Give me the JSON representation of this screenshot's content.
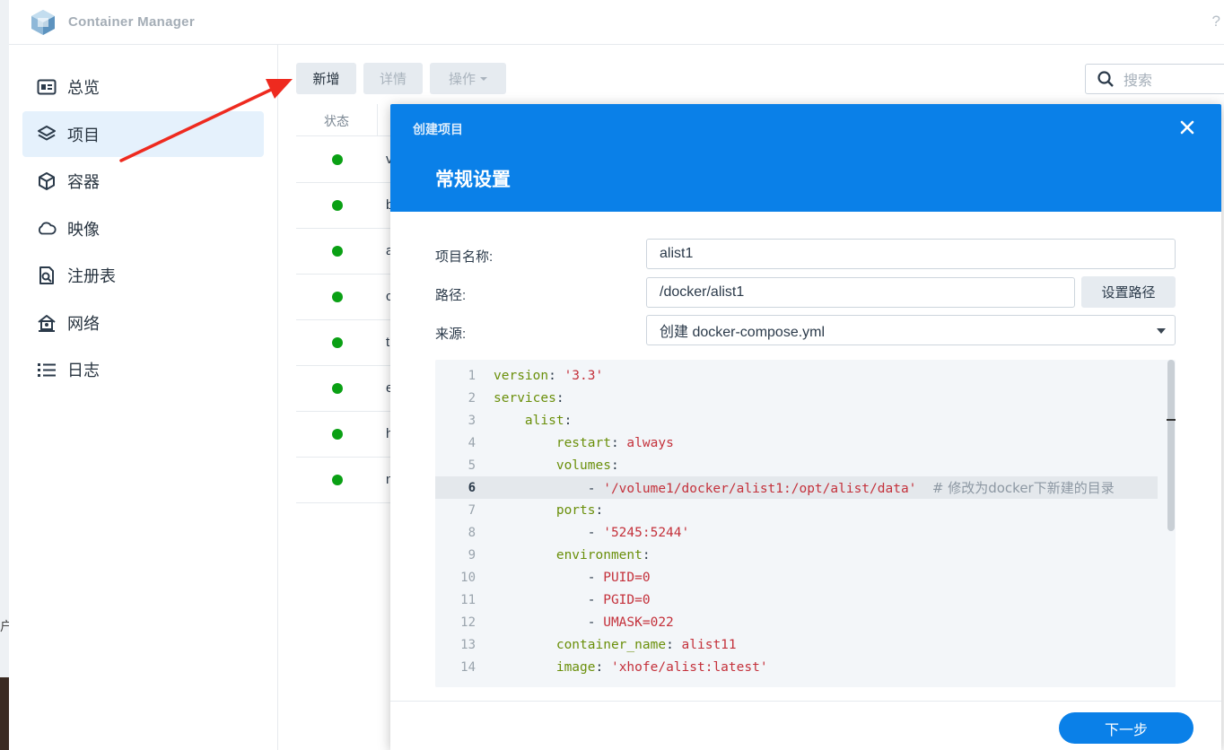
{
  "window": {
    "title": "Container Manager",
    "help_glyph": "?"
  },
  "desktop": {
    "edge_glyph": "户"
  },
  "sidebar": {
    "items": [
      {
        "label": "总览",
        "icon": "overview-card-icon"
      },
      {
        "label": "项目",
        "icon": "layers-icon",
        "active": true
      },
      {
        "label": "容器",
        "icon": "box-icon"
      },
      {
        "label": "映像",
        "icon": "cloud-icon"
      },
      {
        "label": "注册表",
        "icon": "registry-search-icon"
      },
      {
        "label": "网络",
        "icon": "network-home-icon"
      },
      {
        "label": "日志",
        "icon": "list-icon"
      }
    ]
  },
  "toolbar": {
    "new_label": "新增",
    "detail_label": "详情",
    "ops_label": "操作",
    "search_placeholder": "搜索"
  },
  "project_list": {
    "header_status": "状态",
    "rows": [
      {
        "name_fragment": "v",
        "status": "running"
      },
      {
        "name_fragment": "b",
        "status": "running"
      },
      {
        "name_fragment": "a",
        "status": "running"
      },
      {
        "name_fragment": "c",
        "status": "running"
      },
      {
        "name_fragment": "t",
        "status": "running"
      },
      {
        "name_fragment": "e",
        "status": "running"
      },
      {
        "name_fragment": "h",
        "status": "running"
      },
      {
        "name_fragment": "n",
        "status": "running"
      }
    ]
  },
  "dialog": {
    "title": "创建项目",
    "step_title": "常规设置",
    "fields": {
      "name_label": "项目名称:",
      "name_value": "alist1",
      "path_label": "路径:",
      "path_value": "/docker/alist1",
      "set_path_button": "设置路径",
      "source_label": "来源:",
      "source_value": "创建 docker-compose.yml"
    },
    "editor": {
      "current_line": 6,
      "lines": [
        {
          "n": "1",
          "parts": [
            {
              "t": "version",
              "c": "k"
            },
            {
              "t": ": ",
              "c": "p"
            },
            {
              "t": "'3.3'",
              "c": "s"
            }
          ]
        },
        {
          "n": "2",
          "parts": [
            {
              "t": "services",
              "c": "k"
            },
            {
              "t": ":",
              "c": "p"
            }
          ]
        },
        {
          "n": "3",
          "parts": [
            {
              "t": "    alist",
              "c": "k"
            },
            {
              "t": ":",
              "c": "p"
            }
          ]
        },
        {
          "n": "4",
          "parts": [
            {
              "t": "        restart",
              "c": "k"
            },
            {
              "t": ": ",
              "c": "p"
            },
            {
              "t": "always",
              "c": "s"
            }
          ]
        },
        {
          "n": "5",
          "parts": [
            {
              "t": "        volumes",
              "c": "k"
            },
            {
              "t": ":",
              "c": "p"
            }
          ]
        },
        {
          "n": "6",
          "parts": [
            {
              "t": "            - ",
              "c": "p"
            },
            {
              "t": "'/volume1/docker/alist1:/opt/alist/data'",
              "c": "s"
            },
            {
              "t": "  ",
              "c": "p"
            },
            {
              "t": "# 修改为docker下新建的目录",
              "c": "c"
            }
          ]
        },
        {
          "n": "7",
          "parts": [
            {
              "t": "        ports",
              "c": "k"
            },
            {
              "t": ":",
              "c": "p"
            }
          ]
        },
        {
          "n": "8",
          "parts": [
            {
              "t": "            - ",
              "c": "p"
            },
            {
              "t": "'5245:5244'",
              "c": "s"
            }
          ]
        },
        {
          "n": "9",
          "parts": [
            {
              "t": "        environment",
              "c": "k"
            },
            {
              "t": ":",
              "c": "p"
            }
          ]
        },
        {
          "n": "10",
          "parts": [
            {
              "t": "            - ",
              "c": "p"
            },
            {
              "t": "PUID=0",
              "c": "s"
            }
          ]
        },
        {
          "n": "11",
          "parts": [
            {
              "t": "            - ",
              "c": "p"
            },
            {
              "t": "PGID=0",
              "c": "s"
            }
          ]
        },
        {
          "n": "12",
          "parts": [
            {
              "t": "            - ",
              "c": "p"
            },
            {
              "t": "UMASK=022",
              "c": "s"
            }
          ]
        },
        {
          "n": "13",
          "parts": [
            {
              "t": "        container_name",
              "c": "k"
            },
            {
              "t": ": ",
              "c": "p"
            },
            {
              "t": "alist11",
              "c": "s"
            }
          ]
        },
        {
          "n": "14",
          "parts": [
            {
              "t": "        image",
              "c": "k"
            },
            {
              "t": ": ",
              "c": "p"
            },
            {
              "t": "'xhofe/alist:latest'",
              "c": "s"
            }
          ]
        }
      ]
    },
    "next_button": "下一步"
  },
  "colors": {
    "accent": "#0a80e8",
    "status_running": "#0aa014",
    "annotation_arrow": "#ee2a1f"
  }
}
